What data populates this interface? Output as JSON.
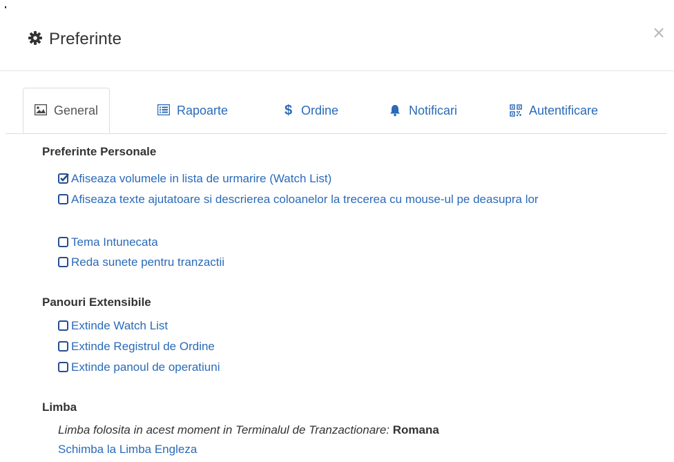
{
  "header": {
    "title": "Preferinte",
    "close_label": "×"
  },
  "tabs": [
    {
      "label": "General",
      "icon": "image-icon",
      "active": true
    },
    {
      "label": "Rapoarte",
      "icon": "list-icon",
      "active": false
    },
    {
      "label": "Ordine",
      "icon": "dollar-icon",
      "active": false
    },
    {
      "label": "Notificari",
      "icon": "bell-icon",
      "active": false
    },
    {
      "label": "Autentificare",
      "icon": "qrcode-icon",
      "active": false
    }
  ],
  "personal": {
    "heading": "Preferinte Personale",
    "options": [
      {
        "label": "Afiseaza volumele in lista de urmarire (Watch List)",
        "checked": true
      },
      {
        "label": "Afiseaza texte ajutatoare si descrierea coloanelor la trecerea cu mouse-ul pe deasupra lor",
        "checked": false
      },
      {
        "label": "Tema Intunecata",
        "checked": false
      },
      {
        "label": "Reda sunete pentru tranzactii",
        "checked": false
      }
    ]
  },
  "panels": {
    "heading": "Panouri Extensibile",
    "options": [
      {
        "label": "Extinde Watch List",
        "checked": false
      },
      {
        "label": "Extinde Registrul de Ordine",
        "checked": false
      },
      {
        "label": "Extinde panoul de operatiuni",
        "checked": false
      }
    ]
  },
  "language": {
    "heading": "Limba",
    "current_text": "Limba folosita in acest moment in Terminalul de Tranzactionare:",
    "current_value": "Romana",
    "switch_link": "Schimba la Limba Engleza"
  },
  "colors": {
    "link": "#2a6ab8",
    "checkbox_border": "#244e8c",
    "text": "#333333"
  }
}
